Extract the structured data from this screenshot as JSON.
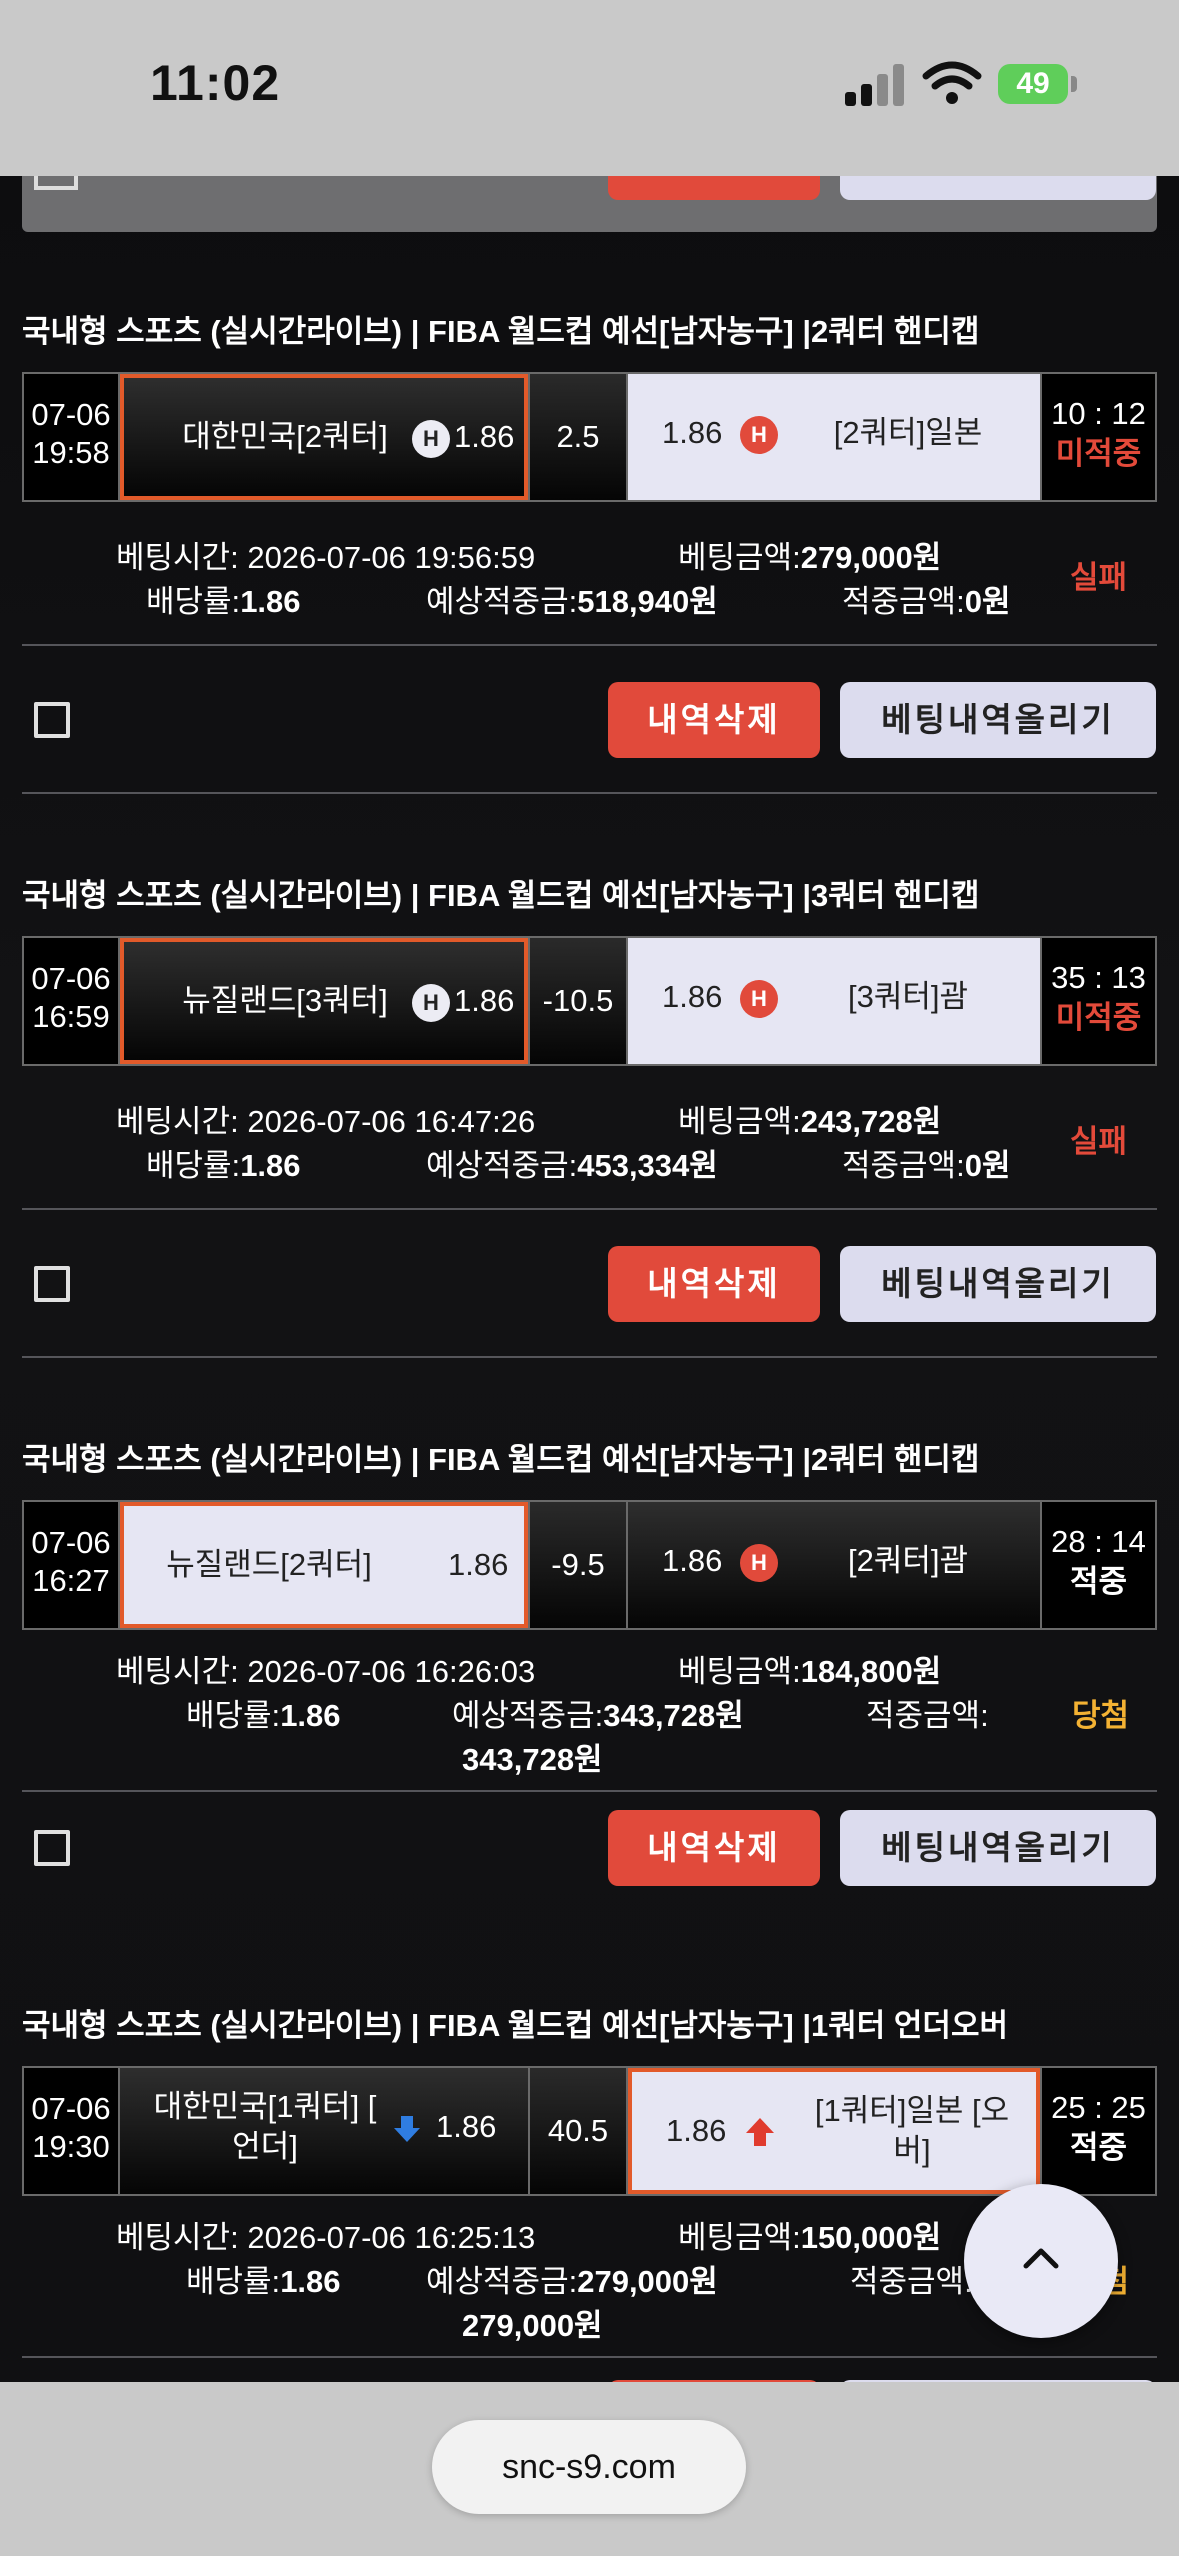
{
  "status_bar": {
    "time": "11:02",
    "battery": "49"
  },
  "browser": {
    "url": "snc-s9.com"
  },
  "actions": {
    "delete_label": "내역삭제",
    "upload_label": "베팅내역올리기"
  },
  "bets": [
    {
      "title": "국내형 스포츠 (실시간라이브) | FIBA 월드컵 예선[남자농구] |2쿼터 핸디캡",
      "date": "07-06",
      "time": "19:58",
      "home_team": "대한민국[2쿼터]",
      "home_odd": "1.86",
      "line": "2.5",
      "away_odd": "1.86",
      "away_team": "[2쿼터]일본",
      "score": "10 : 12",
      "status": "미적중",
      "bet_time_label": "베팅시간:",
      "bet_time": "2026-07-06 19:56:59",
      "bet_amount_label": "베팅금액:",
      "bet_amount": "279,000원",
      "odds_label": "배당률:",
      "odds": "1.86",
      "expected_label": "예상적중금:",
      "expected": "518,940원",
      "win_label": "적중금액:",
      "win_amount": "0원",
      "result": "실패"
    },
    {
      "title": "국내형 스포츠 (실시간라이브) | FIBA 월드컵 예선[남자농구] |3쿼터 핸디캡",
      "date": "07-06",
      "time": "16:59",
      "home_team": "뉴질랜드[3쿼터]",
      "home_odd": "1.86",
      "line": "-10.5",
      "away_odd": "1.86",
      "away_team": "[3쿼터]괌",
      "score": "35 : 13",
      "status": "미적중",
      "bet_time_label": "베팅시간:",
      "bet_time": "2026-07-06 16:47:26",
      "bet_amount_label": "베팅금액:",
      "bet_amount": "243,728원",
      "odds_label": "배당률:",
      "odds": "1.86",
      "expected_label": "예상적중금:",
      "expected": "453,334원",
      "win_label": "적중금액:",
      "win_amount": "0원",
      "result": "실패"
    },
    {
      "title": "국내형 스포츠 (실시간라이브) | FIBA 월드컵 예선[남자농구] |2쿼터 핸디캡",
      "date": "07-06",
      "time": "16:27",
      "home_team": "뉴질랜드[2쿼터]",
      "home_odd": "1.86",
      "line": "-9.5",
      "away_odd": "1.86",
      "away_team": "[2쿼터]괌",
      "score": "28 : 14",
      "status": "적중",
      "bet_time_label": "베팅시간:",
      "bet_time": "2026-07-06 16:26:03",
      "bet_amount_label": "베팅금액:",
      "bet_amount": "184,800원",
      "odds_label": "배당률:",
      "odds": "1.86",
      "expected_label": "예상적중금:",
      "expected": "343,728원",
      "win_label": "적중금액:",
      "win_amount": "343,728원",
      "result": "당첨"
    },
    {
      "title": "국내형 스포츠 (실시간라이브) | FIBA 월드컵 예선[남자농구] |1쿼터 언더오버",
      "date": "07-06",
      "time": "19:30",
      "home_team_line1": "대한민국[1쿼터] [",
      "home_team_line2": "언더]",
      "home_odd": "1.86",
      "line": "40.5",
      "away_odd": "1.86",
      "away_team_line1": "[1쿼터]일본 [오",
      "away_team_line2": "버]",
      "score": "25 : 25",
      "status": "적중",
      "bet_time_label": "베팅시간:",
      "bet_time": "2026-07-06 16:25:13",
      "bet_amount_label": "베팅금액:",
      "bet_amount": "150,000원",
      "odds_label": "배당률:",
      "odds": "1.86",
      "expected_label": "예상적중금:",
      "expected": "279,000원",
      "win_label": "적중금액:",
      "win_amount": "279,000원",
      "result": "당첨"
    }
  ],
  "icons": {
    "handicap_badge_letter": "H",
    "scroll_top": "chevron-up-icon"
  },
  "colors": {
    "accent_red": "#e14a3b",
    "selected_border": "#e25a2a",
    "win_gold": "#f4b233",
    "light_cell": "#e6e6f3"
  }
}
